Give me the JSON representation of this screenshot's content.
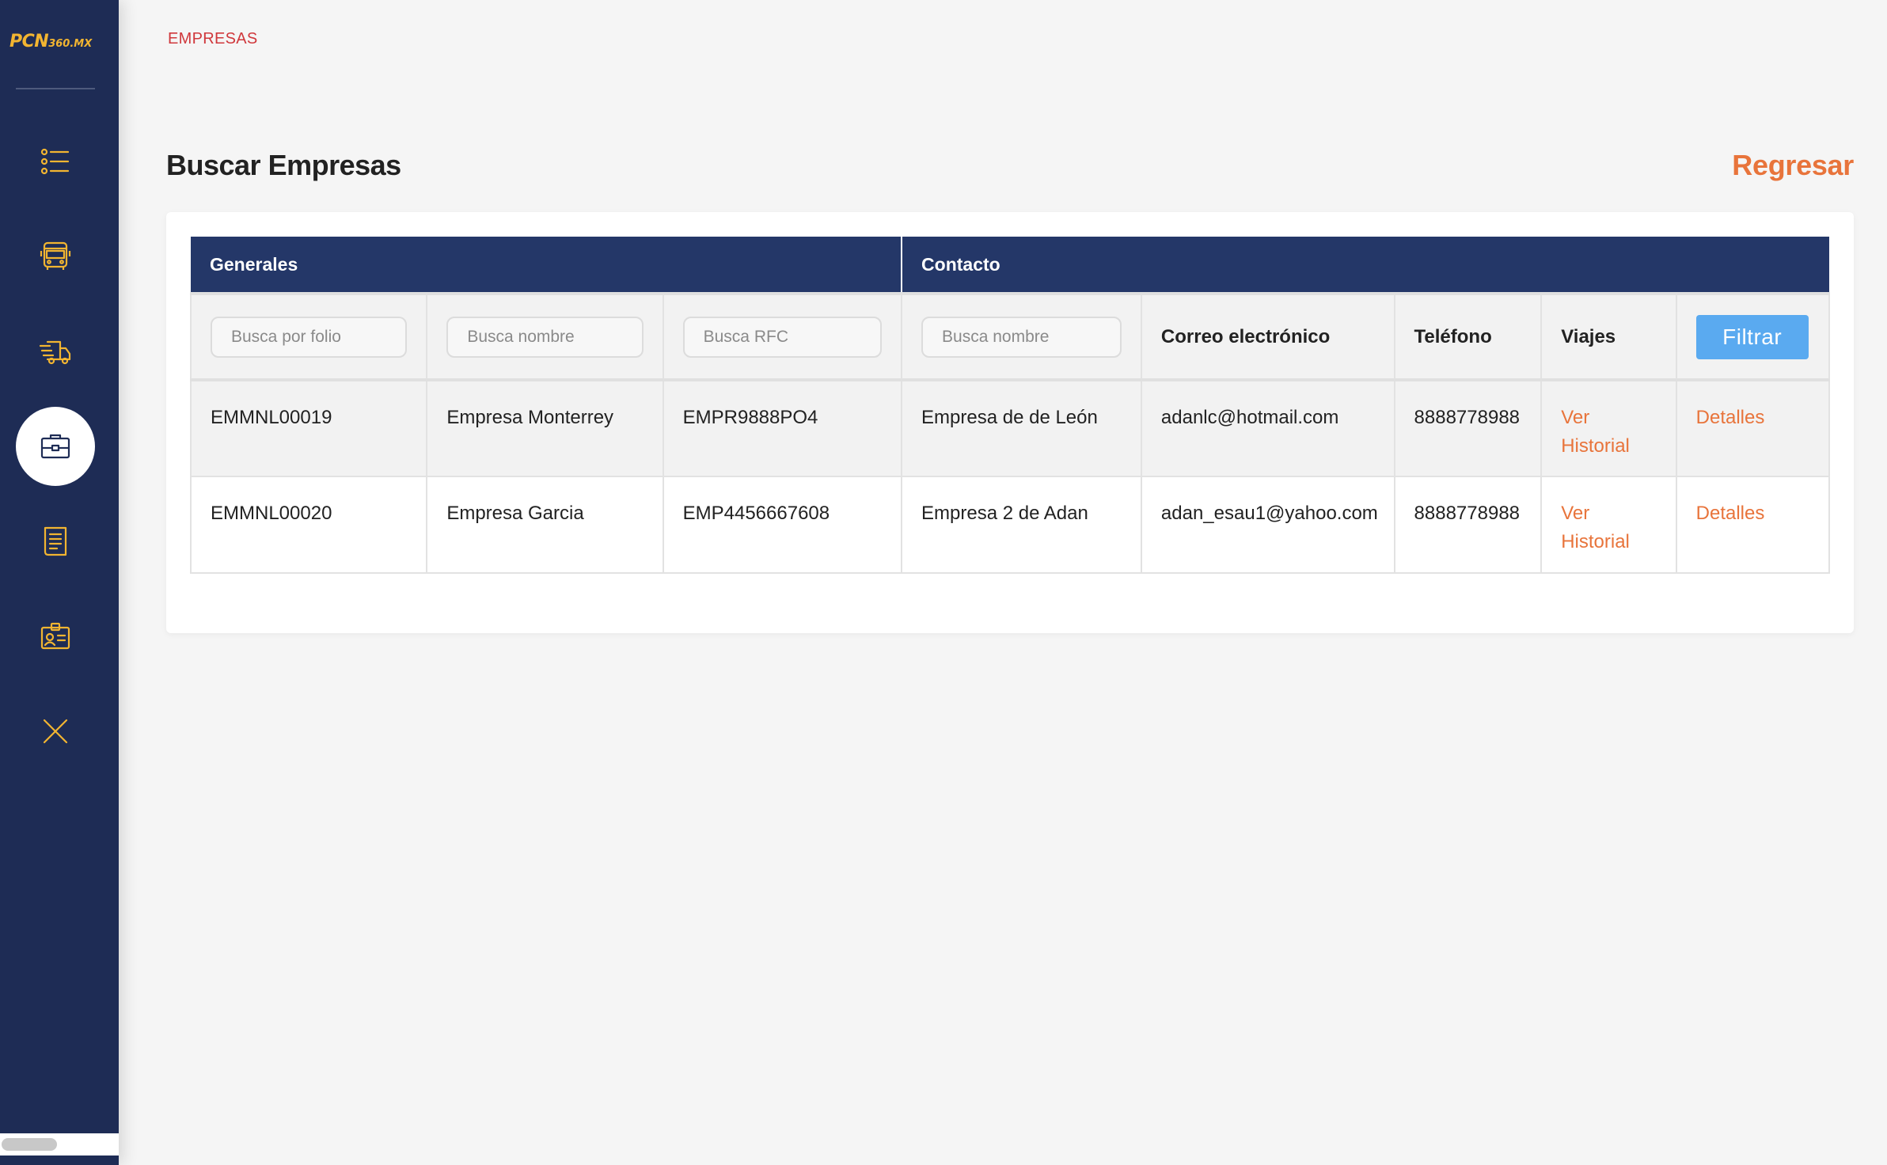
{
  "app": {
    "logo_main": "PCN",
    "logo_suffix": "360.MX"
  },
  "sidebar": {
    "items": [
      {
        "icon": "list-icon",
        "active": false
      },
      {
        "icon": "bus-icon",
        "active": false
      },
      {
        "icon": "delivery-truck-icon",
        "active": false
      },
      {
        "icon": "briefcase-icon",
        "active": true
      },
      {
        "icon": "document-icon",
        "active": false
      },
      {
        "icon": "id-card-icon",
        "active": false
      },
      {
        "icon": "close-icon",
        "active": false
      }
    ]
  },
  "breadcrumb": "EMPRESAS",
  "page": {
    "title": "Buscar Empresas",
    "back_label": "Regresar"
  },
  "table": {
    "groups": [
      "Generales",
      "Contacto"
    ],
    "filters": {
      "folio_placeholder": "Busca por folio",
      "nombre_placeholder": "Busca nombre",
      "rfc_placeholder": "Busca RFC",
      "contacto_placeholder": "Busca nombre",
      "correo_header": "Correo electrónico",
      "telefono_header": "Teléfono",
      "viajes_header": "Viajes",
      "filter_button": "Filtrar"
    },
    "rows": [
      {
        "folio": "EMMNL00019",
        "nombre": "Empresa Monterrey",
        "rfc": "EMPR9888PO4",
        "contacto": "Empresa de de León",
        "correo": "adanlc@hotmail.com",
        "telefono": "8888778988",
        "viajes_line1": "Ver",
        "viajes_line2": "Historial",
        "detalles": "Detalles"
      },
      {
        "folio": "EMMNL00020",
        "nombre": "Empresa Garcia",
        "rfc": "EMP4456667608",
        "contacto": "Empresa 2 de Adan",
        "correo": "adan_esau1@yahoo.com",
        "telefono": "8888778988",
        "viajes_line1": "Ver",
        "viajes_line2": "Historial",
        "detalles": "Detalles"
      }
    ]
  },
  "colors": {
    "sidebar_bg": "#1e2c55",
    "icon_accent": "#f2b531",
    "table_header_bg": "#243768",
    "link_orange": "#e8743b",
    "breadcrumb_red": "#d0383c",
    "filter_button_blue": "#5aaaf0"
  }
}
